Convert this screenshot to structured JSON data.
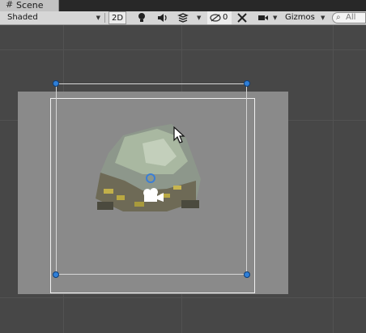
{
  "tab": {
    "label": "Scene",
    "icon": "grid-icon"
  },
  "toolbar": {
    "shading_mode": "Shaded",
    "toggle_2d": "2D",
    "hidden_count": "0",
    "gizmos_label": "Gizmos",
    "search_placeholder": "All"
  },
  "icons": [
    "grid-icon",
    "lighting-icon",
    "audio-icon",
    "effects-icon",
    "visibility-icon",
    "tools-icon",
    "camera-icon",
    "search-icon",
    "pivot-icon",
    "cursor-icon"
  ]
}
